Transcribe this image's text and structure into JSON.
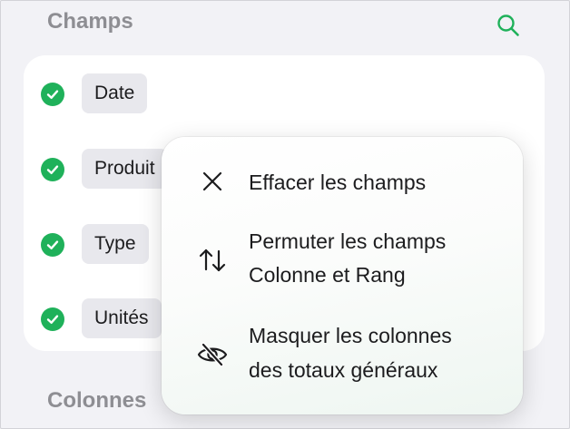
{
  "sections": {
    "champs_title": "Champs",
    "colonnes_title": "Colonnes"
  },
  "fields": [
    {
      "label": "Date",
      "checked": true
    },
    {
      "label": "Produit",
      "checked": true
    },
    {
      "label": "Type",
      "checked": true
    },
    {
      "label": "Unités",
      "checked": true
    }
  ],
  "menu": {
    "items": [
      {
        "icon": "close-icon",
        "line1": "Effacer les champs",
        "line2": ""
      },
      {
        "icon": "swap-arrows-icon",
        "line1": "Permuter les champs",
        "line2": "Colonne et Rang"
      },
      {
        "icon": "eye-slash-icon",
        "line1": "Masquer les colonnes",
        "line2": "des totaux généraux"
      }
    ]
  },
  "colors": {
    "accent": "#1fb15a",
    "chip_background": "#e8e8ed",
    "section_title": "#8e8e93"
  }
}
